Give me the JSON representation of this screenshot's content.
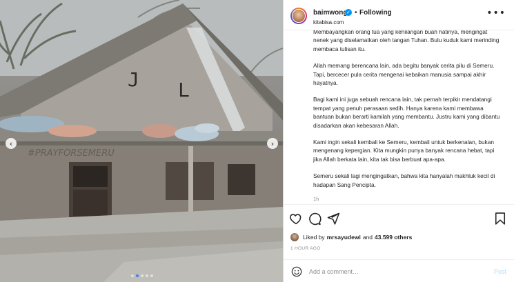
{
  "post": {
    "author": "baimwong",
    "follow_separator": "•",
    "follow_status": "Following",
    "subtitle": "kitabisa.com"
  },
  "caption": {
    "paragraphs": [
      "Membayangkan orang tua yang kehilangan buah hatinya, mengingat nenek yang diselamatkan oleh tangan Tuhan. Bulu kuduk kami merinding membaca tulisan itu.",
      "Allah memang berencana lain, ada begitu banyak cerita pilu di Semeru. Tapi, bercecer pula cerita mengenai kebaikan manusia sampai akhir hayatnya.",
      "Bagi kami ini juga sebuah rencana lain, tak pernah terpikir mendatangi tempat yang penuh perasaan sedih. Hanya karena kami membawa bantuan bukan berarti kamilah yang membantu. Justru kami yang dibantu disadarkan akan kebesaran Allah.",
      "Kami ingin sekali kembali ke Semeru, kembali untuk berkenalan, bukan mengenang kepergian. Kita mungkin punya banyak rencana hebat, tapi jika Allah berkata lain, kita tak bisa berbuat apa-apa.",
      "Semeru sekali lagi mengingatkan, bahwa kita hanyalah makhluk kecil di hadapan Sang Pencipta."
    ],
    "time_ago": "1h"
  },
  "likes": {
    "prefix": "Liked by",
    "user": "mrsayudewi",
    "and": "and",
    "others": "43.599 others"
  },
  "post_date": "1 HOUR AGO",
  "comment": {
    "placeholder": "Add a comment…",
    "post_label": "Post"
  },
  "carousel": {
    "prev_glyph": "‹",
    "next_glyph": "›",
    "slide_count": 5,
    "active_slide": 1
  },
  "colors": {
    "accent": "#0095f6",
    "post_disabled": "#b2dffc",
    "text": "#262626",
    "muted": "#8e8e8e"
  },
  "icons": [
    "verified-icon",
    "more-icon",
    "heart-icon",
    "comment-icon",
    "share-icon",
    "bookmark-icon",
    "emoji-icon",
    "chevron-left-icon",
    "chevron-right-icon"
  ]
}
